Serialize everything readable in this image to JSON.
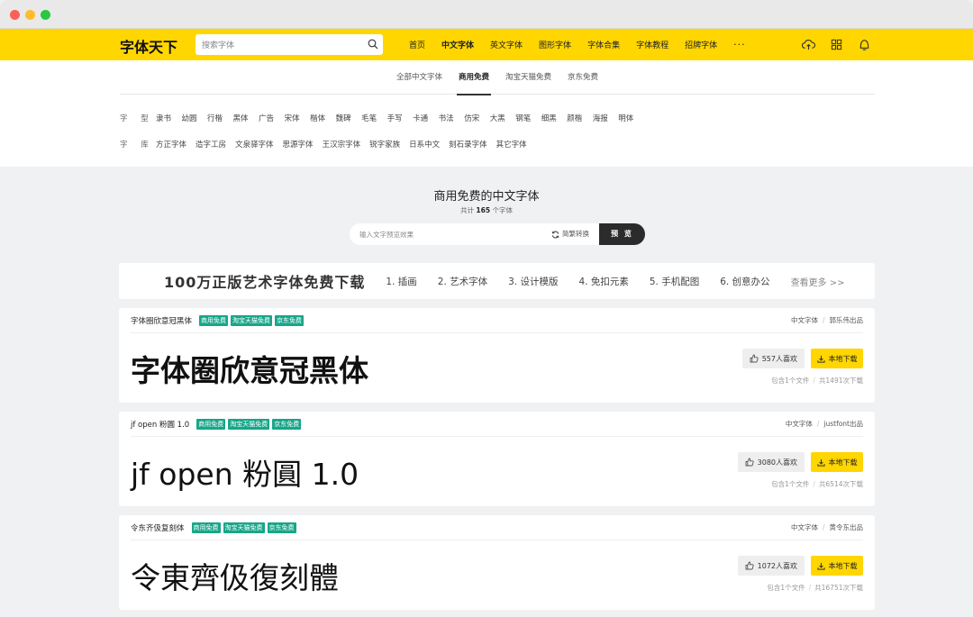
{
  "nav": {
    "logo": "字体天下",
    "search_placeholder": "搜索字体",
    "links": [
      "首页",
      "中文字体",
      "英文字体",
      "图形字体",
      "字体合集",
      "字体教程",
      "招牌字体",
      "···"
    ],
    "active": "中文字体",
    "icons": [
      "upload-icon",
      "grid-icon",
      "user-icon"
    ],
    "accent": "#ffd600"
  },
  "subtabs": {
    "items": [
      "全部中文字体",
      "商用免费",
      "淘宝天猫免费",
      "京东免费"
    ],
    "active": "商用免费"
  },
  "filters": {
    "type_label": "字 型",
    "types": [
      "隶书",
      "幼圆",
      "行楷",
      "黑体",
      "广告",
      "宋体",
      "楷体",
      "魏碑",
      "毛笔",
      "手写",
      "卡通",
      "书法",
      "仿宋",
      "大黑",
      "钢笔",
      "细黑",
      "颜楷",
      "海报",
      "明体"
    ],
    "library_label": "字 库",
    "libraries": [
      "方正字体",
      "造字工房",
      "文泉驿字体",
      "思源字体",
      "王汉宗字体",
      "锐字家族",
      "日系中文",
      "刻石录字体",
      "其它字体"
    ]
  },
  "main": {
    "heading": "商用免费的中文字体",
    "count_prefix": "共计",
    "count": "165",
    "count_suffix": "个字体",
    "preview_placeholder": "输入文字预览效果",
    "convert_label": "简繁转换",
    "preview_button": "预 览"
  },
  "banner": {
    "title": "100万正版艺术字体免费下载",
    "items": [
      "1. 插画",
      "2. 艺术字体",
      "3. 设计模版",
      "4. 免扣元素",
      "5. 手机配图",
      "6. 创意办公"
    ],
    "more": "查看更多 >>"
  },
  "fonts": [
    {
      "name": "字体圈欣意冠黑体",
      "tags": [
        "商用免费",
        "淘宝天猫免费",
        "京东免费"
      ],
      "category": "中文字体",
      "author": "郭乐伟出品",
      "sample": "字体圈欣意冠黑体",
      "likes": "557人喜欢",
      "download": "本地下载",
      "files": "包含1个文件",
      "downloads": "共1491次下载"
    },
    {
      "name": "jf open 粉圓 1.0",
      "tags": [
        "商用免费",
        "淘宝天猫免费",
        "京东免费"
      ],
      "category": "中文字体",
      "author": "justfont出品",
      "sample": "jf open 粉圓 1.0",
      "likes": "3080人喜欢",
      "download": "本地下载",
      "files": "包含1个文件",
      "downloads": "共6514次下载"
    },
    {
      "name": "令东齐伋复刻体",
      "tags": [
        "商用免费",
        "淘宝天猫免费",
        "京东免费"
      ],
      "category": "中文字体",
      "author": "黄令东出品",
      "sample": "令東齊伋復刻體",
      "likes": "1072人喜欢",
      "download": "本地下载",
      "files": "包含1个文件",
      "downloads": "共16751次下载"
    }
  ]
}
